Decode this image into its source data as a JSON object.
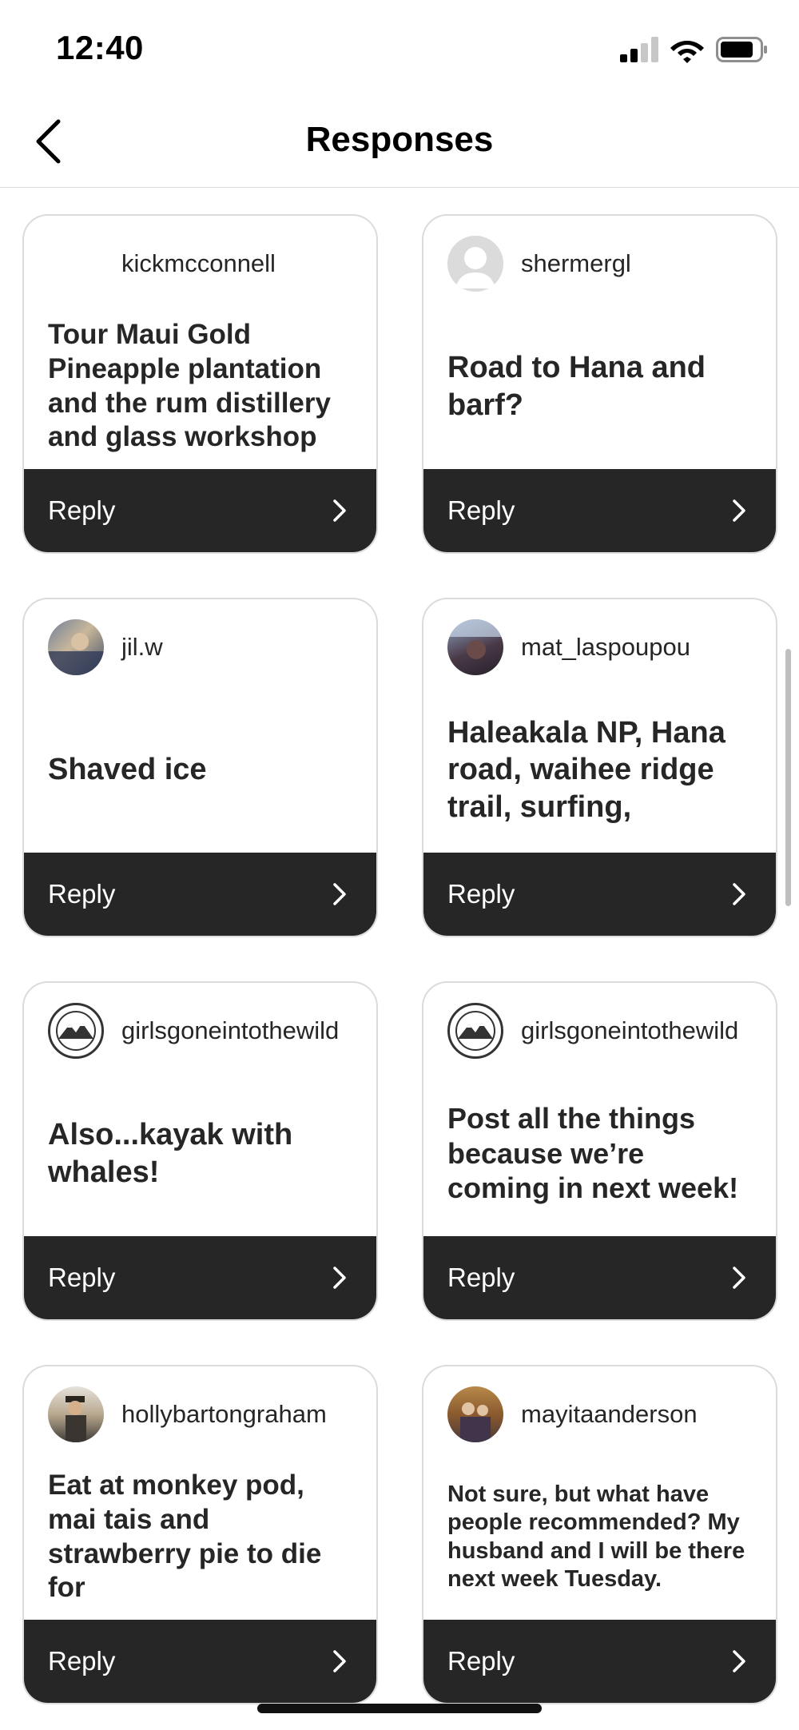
{
  "status_bar": {
    "time": "12:40"
  },
  "nav": {
    "title": "Responses"
  },
  "reply_label": "Reply",
  "responses": [
    {
      "username": "kickmcconnell",
      "text": "Tour Maui Gold Pineapple plantation and the rum distillery and glass workshop"
    },
    {
      "username": "shermergl",
      "text": "Road to Hana and barf?"
    },
    {
      "username": "jil.w",
      "text": "Shaved ice"
    },
    {
      "username": "mat_laspoupou",
      "text": "Haleakala NP, Hana road, waihee ridge trail, surfing,"
    },
    {
      "username": "girlsgoneintothewild",
      "text": "Also...kayak with whales!"
    },
    {
      "username": "girlsgoneintothewild",
      "text": "Post all the things because we’re coming in next week!"
    },
    {
      "username": "hollybartongraham",
      "text": "Eat at monkey pod, mai tais and strawberry pie to die for"
    },
    {
      "username": "mayitaanderson",
      "text": "Not sure, but what have people recommended? My husband and I will be there next week Tuesday."
    }
  ]
}
